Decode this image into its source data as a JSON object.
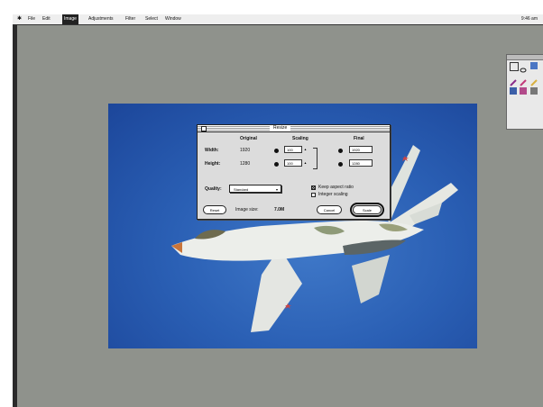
{
  "menubar": {
    "apple": "✱",
    "items": [
      "File",
      "Edit",
      "Image",
      "Adjustments",
      "Filter",
      "Select",
      "Window"
    ],
    "selected_index": 2,
    "clock": "9:46 am"
  },
  "dialog": {
    "title": "Resize",
    "col_headers": [
      "Original",
      "Scaling",
      "Final"
    ],
    "rows": [
      {
        "label": "Width:",
        "original": "1920",
        "scaling": "100",
        "final": "1920"
      },
      {
        "label": "Height:",
        "original": "1280",
        "scaling": "100",
        "final": "1280"
      }
    ],
    "quality_label": "Quality:",
    "quality_value": "Standard",
    "checkboxes": [
      {
        "label": "Keep aspect ratio",
        "checked": true
      },
      {
        "label": "Integer scaling",
        "checked": false
      }
    ],
    "reset_label": "Reset",
    "image_size_label": "Image size:",
    "image_size_value": "7.0M",
    "cancel_label": "Cancel",
    "ok_label": "Scale"
  },
  "icons": {
    "close": "close-box-icon",
    "link": "link-icon",
    "popup_arrow": "triangle-down-icon"
  },
  "colors": {
    "desktop": "#8f928c",
    "sky": "#2a5fb4",
    "dialog": "#dcdcdc"
  }
}
